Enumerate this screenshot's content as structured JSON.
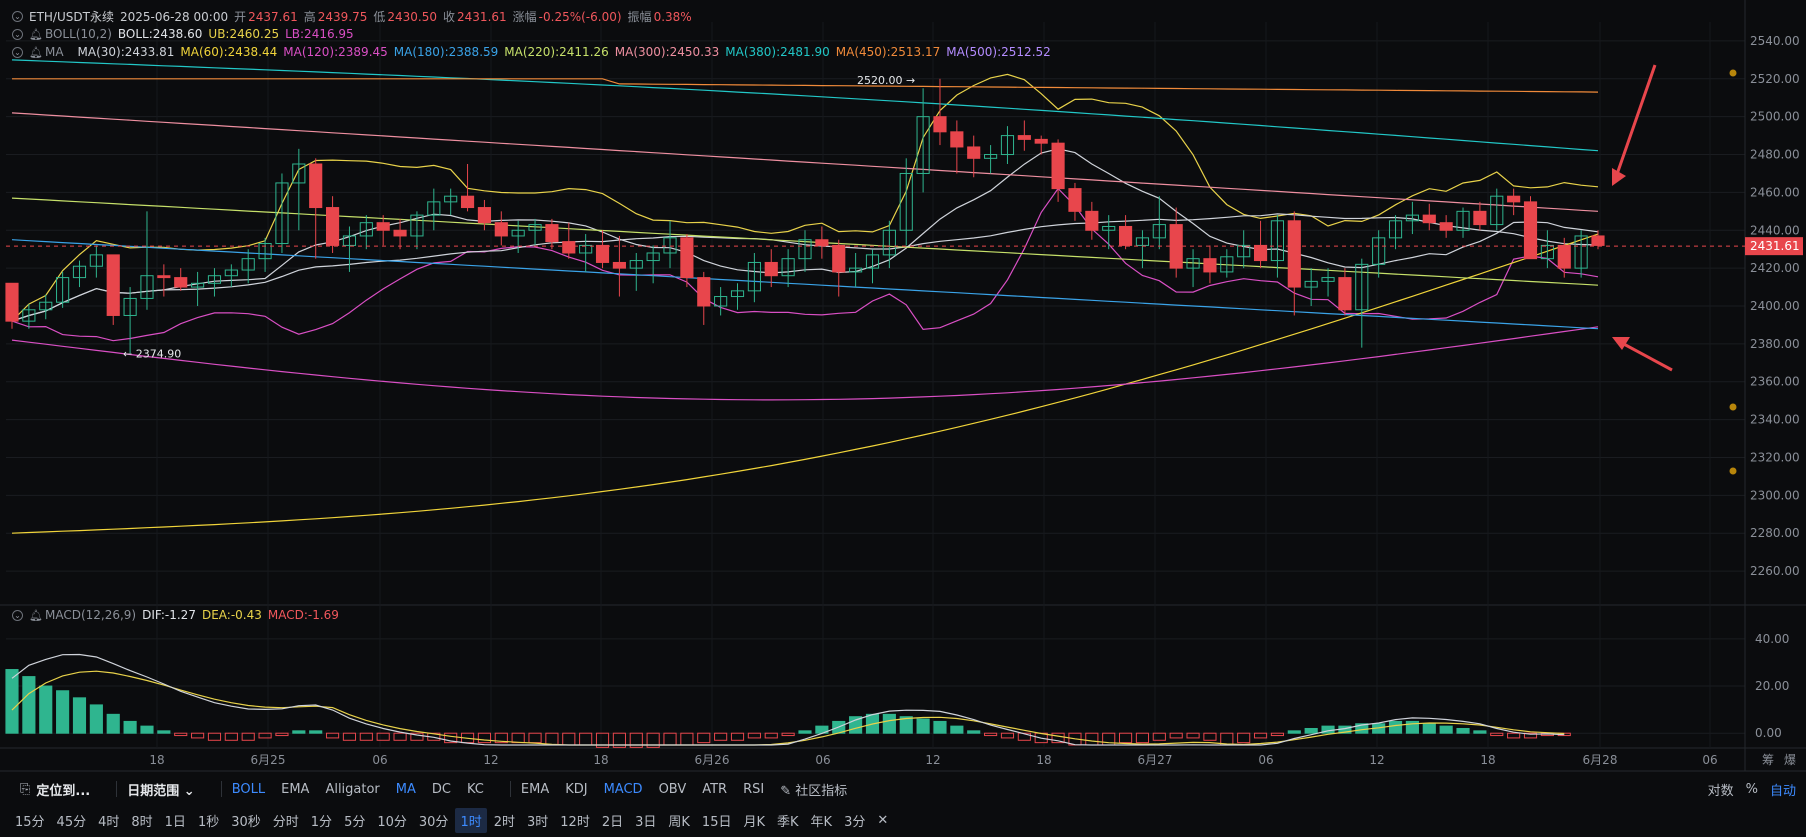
{
  "header": {
    "symbol": "ETH/USDT永续",
    "datetime": "2025-06-28 00:00",
    "open_label": "开",
    "open": "2437.61",
    "high_label": "高",
    "high": "2439.75",
    "low_label": "低",
    "low": "2430.50",
    "close_label": "收",
    "close": "2431.61",
    "change_label": "涨幅",
    "change": "-0.25%(-6.00)",
    "amp_label": "振幅",
    "amp": "0.38%"
  },
  "boll": {
    "name": "BOLL(10,2)",
    "mid": "BOLL:2438.60",
    "ub": "UB:2460.25",
    "lb": "LB:2416.95",
    "colors": {
      "mid": "#cfd3da",
      "ub": "#e8d24a",
      "lb": "#d94fc4"
    }
  },
  "ma": {
    "name": "MA",
    "items": [
      {
        "label": "MA(30):2433.81",
        "color": "#cfd3da"
      },
      {
        "label": "MA(60):2438.44",
        "color": "#f0d43a"
      },
      {
        "label": "MA(120):2389.45",
        "color": "#d94fc4"
      },
      {
        "label": "MA(180):2388.59",
        "color": "#3aa3e8"
      },
      {
        "label": "MA(220):2411.26",
        "color": "#c6e06a"
      },
      {
        "label": "MA(300):2450.33",
        "color": "#ee8fa0"
      },
      {
        "label": "MA(380):2481.90",
        "color": "#22c7c7"
      },
      {
        "label": "MA(450):2513.17",
        "color": "#f08a3a"
      },
      {
        "label": "MA(500):2512.52",
        "color": "#b48cff"
      }
    ]
  },
  "macd": {
    "name": "MACD(12,26,9)",
    "dif": "DIF:-1.27",
    "dea": "DEA:-0.43",
    "macd": "MACD:-1.69"
  },
  "chart_data": {
    "type": "candlestick",
    "price_axis": {
      "range": [
        2250,
        2550
      ],
      "ticks": [
        "2540.00",
        "2520.00",
        "2500.00",
        "2480.00",
        "2460.00",
        "2440.00",
        "2420.00",
        "2400.00",
        "2380.00",
        "2360.00",
        "2340.00",
        "2320.00",
        "2300.00",
        "2280.00",
        "2260.00"
      ]
    },
    "macd_axis": {
      "range": [
        -5,
        48
      ],
      "ticks": [
        "40.00",
        "20.00",
        "0.00"
      ]
    },
    "time_axis": [
      "18",
      "6月25",
      "06",
      "12",
      "18",
      "6月26",
      "06",
      "12",
      "18",
      "6月27",
      "06",
      "12",
      "18",
      "6月28",
      "06"
    ],
    "last_price": "2431.61",
    "high_marker": "2520.00",
    "low_marker": "2374.90",
    "candles": [
      [
        2412,
        2412,
        2388,
        2392
      ],
      [
        2392,
        2401,
        2388,
        2398
      ],
      [
        2398,
        2406,
        2393,
        2402
      ],
      [
        2402,
        2418,
        2399,
        2415
      ],
      [
        2415,
        2424,
        2410,
        2421
      ],
      [
        2421,
        2432,
        2415,
        2427
      ],
      [
        2427,
        2427,
        2390,
        2395
      ],
      [
        2395,
        2410,
        2375,
        2404
      ],
      [
        2404,
        2450,
        2398,
        2416
      ],
      [
        2416,
        2422,
        2405,
        2415
      ],
      [
        2415,
        2420,
        2408,
        2410
      ],
      [
        2410,
        2418,
        2400,
        2412
      ],
      [
        2412,
        2420,
        2405,
        2416
      ],
      [
        2416,
        2422,
        2410,
        2419
      ],
      [
        2419,
        2430,
        2412,
        2425
      ],
      [
        2425,
        2436,
        2418,
        2433
      ],
      [
        2433,
        2470,
        2428,
        2465
      ],
      [
        2465,
        2483,
        2440,
        2475
      ],
      [
        2475,
        2478,
        2425,
        2452
      ],
      [
        2452,
        2458,
        2428,
        2432
      ],
      [
        2432,
        2442,
        2418,
        2437
      ],
      [
        2437,
        2448,
        2430,
        2444
      ],
      [
        2444,
        2448,
        2432,
        2440
      ],
      [
        2440,
        2446,
        2430,
        2437
      ],
      [
        2437,
        2450,
        2430,
        2448
      ],
      [
        2448,
        2462,
        2440,
        2455
      ],
      [
        2455,
        2462,
        2448,
        2458
      ],
      [
        2458,
        2475,
        2450,
        2452
      ],
      [
        2452,
        2456,
        2440,
        2444
      ],
      [
        2444,
        2450,
        2432,
        2437
      ],
      [
        2437,
        2445,
        2428,
        2440
      ],
      [
        2440,
        2446,
        2432,
        2443
      ],
      [
        2443,
        2446,
        2430,
        2434
      ],
      [
        2434,
        2444,
        2425,
        2428
      ],
      [
        2428,
        2438,
        2418,
        2432
      ],
      [
        2432,
        2440,
        2420,
        2423
      ],
      [
        2423,
        2437,
        2405,
        2420
      ],
      [
        2420,
        2428,
        2408,
        2424
      ],
      [
        2424,
        2432,
        2412,
        2428
      ],
      [
        2428,
        2445,
        2420,
        2436
      ],
      [
        2436,
        2438,
        2410,
        2415
      ],
      [
        2415,
        2418,
        2390,
        2400
      ],
      [
        2400,
        2410,
        2395,
        2405
      ],
      [
        2405,
        2412,
        2398,
        2408
      ],
      [
        2408,
        2428,
        2402,
        2423
      ],
      [
        2423,
        2430,
        2410,
        2416
      ],
      [
        2416,
        2430,
        2410,
        2425
      ],
      [
        2425,
        2440,
        2418,
        2435
      ],
      [
        2435,
        2442,
        2425,
        2432
      ],
      [
        2432,
        2435,
        2405,
        2418
      ],
      [
        2418,
        2428,
        2410,
        2420
      ],
      [
        2420,
        2430,
        2412,
        2427
      ],
      [
        2427,
        2445,
        2420,
        2440
      ],
      [
        2440,
        2478,
        2432,
        2470
      ],
      [
        2470,
        2515,
        2460,
        2500
      ],
      [
        2500,
        2520,
        2485,
        2492
      ],
      [
        2492,
        2498,
        2470,
        2484
      ],
      [
        2484,
        2490,
        2468,
        2478
      ],
      [
        2478,
        2485,
        2470,
        2480
      ],
      [
        2480,
        2495,
        2475,
        2490
      ],
      [
        2490,
        2498,
        2482,
        2488
      ],
      [
        2488,
        2490,
        2480,
        2486
      ],
      [
        2486,
        2488,
        2455,
        2462
      ],
      [
        2462,
        2465,
        2445,
        2450
      ],
      [
        2450,
        2455,
        2435,
        2440
      ],
      [
        2440,
        2448,
        2430,
        2442
      ],
      [
        2442,
        2448,
        2430,
        2432
      ],
      [
        2432,
        2440,
        2420,
        2436
      ],
      [
        2436,
        2458,
        2430,
        2443
      ],
      [
        2443,
        2452,
        2415,
        2420
      ],
      [
        2420,
        2430,
        2410,
        2425
      ],
      [
        2425,
        2432,
        2412,
        2418
      ],
      [
        2418,
        2430,
        2415,
        2426
      ],
      [
        2426,
        2440,
        2420,
        2432
      ],
      [
        2432,
        2445,
        2420,
        2424
      ],
      [
        2424,
        2448,
        2415,
        2445
      ],
      [
        2445,
        2450,
        2395,
        2410
      ],
      [
        2410,
        2420,
        2400,
        2413
      ],
      [
        2413,
        2420,
        2405,
        2415
      ],
      [
        2415,
        2420,
        2395,
        2398
      ],
      [
        2398,
        2425,
        2378,
        2422
      ],
      [
        2422,
        2440,
        2415,
        2436
      ],
      [
        2436,
        2448,
        2430,
        2445
      ],
      [
        2445,
        2455,
        2438,
        2448
      ],
      [
        2448,
        2454,
        2440,
        2444
      ],
      [
        2444,
        2448,
        2436,
        2440
      ],
      [
        2440,
        2452,
        2436,
        2450
      ],
      [
        2450,
        2455,
        2440,
        2443
      ],
      [
        2443,
        2462,
        2440,
        2458
      ],
      [
        2458,
        2462,
        2448,
        2455
      ],
      [
        2455,
        2458,
        2428,
        2425
      ],
      [
        2425,
        2440,
        2420,
        2432
      ],
      [
        2432,
        2436,
        2415,
        2420
      ],
      [
        2420,
        2440,
        2415,
        2437
      ],
      [
        2437,
        2440,
        2430,
        2432
      ]
    ],
    "macd_hist": [
      27,
      24,
      20,
      18,
      15,
      12,
      8,
      5,
      3,
      1,
      -1,
      -2,
      -3,
      -3,
      -3,
      -2,
      -1,
      1,
      1,
      -2,
      -3,
      -3,
      -3,
      -3,
      -3,
      -3,
      -4,
      -4,
      -4,
      -4,
      -4,
      -4,
      -5,
      -5,
      -5,
      -6,
      -6,
      -6,
      -6,
      -5,
      -5,
      -4,
      -3,
      -3,
      -2,
      -2,
      -1,
      1,
      3,
      5,
      7,
      8,
      8,
      7,
      6,
      5,
      3,
      1,
      -1,
      -2,
      -3,
      -4,
      -4,
      -5,
      -5,
      -5,
      -4,
      -4,
      -3,
      -2,
      -2,
      -3,
      -5,
      -4,
      -2,
      -1,
      1,
      2,
      3,
      3,
      4,
      4,
      5,
      5,
      4,
      3,
      2,
      1,
      -1,
      -2,
      -2,
      -1,
      -1
    ]
  },
  "toolbar": {
    "locate": "定位到...",
    "range": "日期范围",
    "overlay": [
      "BOLL",
      "EMA",
      "Alligator",
      "MA",
      "DC",
      "KC"
    ],
    "sub": [
      "EMA",
      "KDJ",
      "MACD",
      "OBV",
      "ATR",
      "RSI"
    ],
    "community": "社区指标",
    "right": [
      "对数",
      "%",
      "自动"
    ],
    "timeframes": [
      "15分",
      "45分",
      "4时",
      "8时",
      "1日",
      "1秒",
      "30秒",
      "分时",
      "1分",
      "5分",
      "10分",
      "30分",
      "1时",
      "2时",
      "3时",
      "12时",
      "2日",
      "3日",
      "周K",
      "15日",
      "月K",
      "季K",
      "年K",
      "3分"
    ],
    "active_timeframe": "1时",
    "corner_labels": [
      "筹",
      "爆"
    ]
  }
}
